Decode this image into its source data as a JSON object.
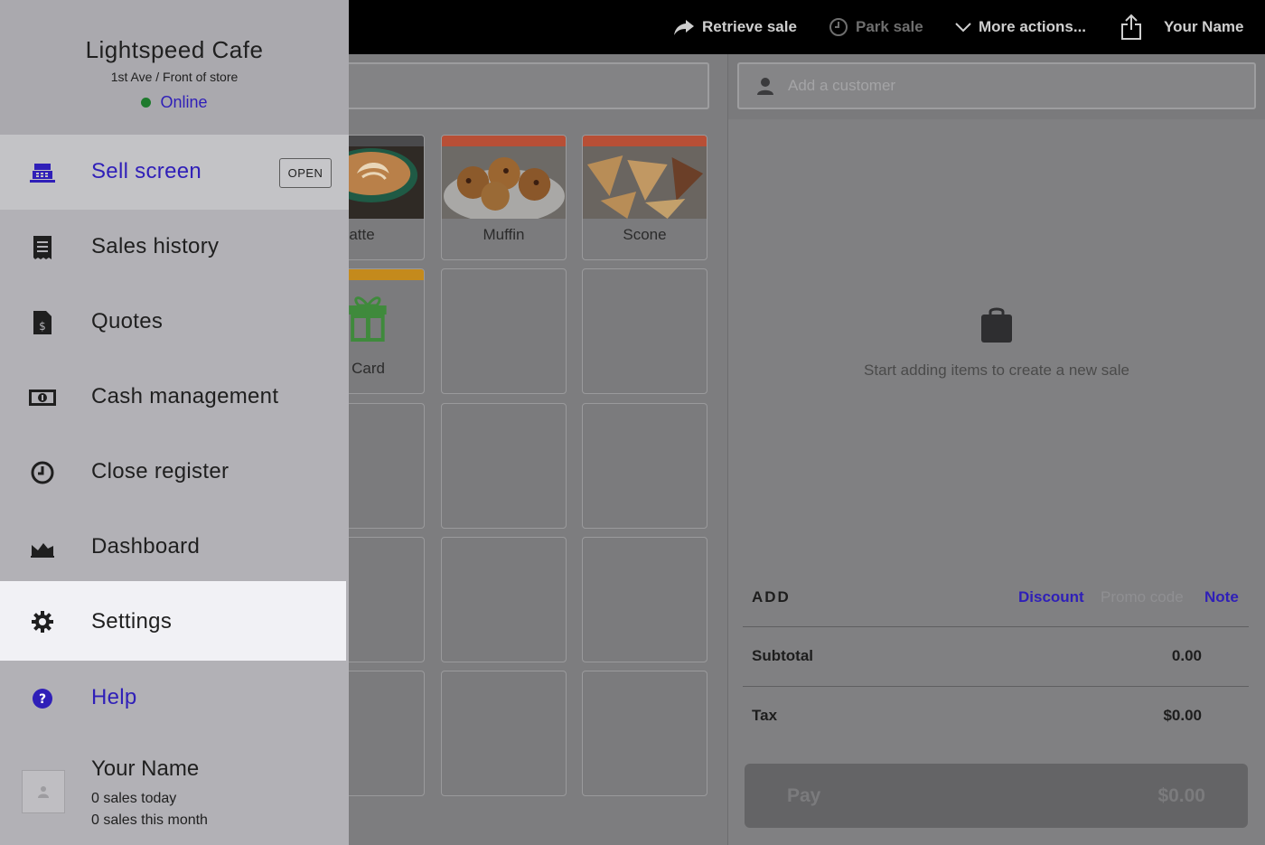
{
  "topbar": {
    "retrieve_sale": "Retrieve sale",
    "park_sale": "Park sale",
    "more_actions": "More actions...",
    "user_name": "Your Name"
  },
  "customer": {
    "placeholder": "Add a customer"
  },
  "products": [
    {
      "label": "atte",
      "bar_color": "#4a4a4c"
    },
    {
      "label": "Muffin",
      "bar_color": "#b84f36"
    },
    {
      "label": "Scone",
      "bar_color": "#b84f36"
    },
    {
      "label": "ft Card",
      "bar_color": "#c48a1c"
    }
  ],
  "sale": {
    "empty_message": "Start adding items to create a new sale",
    "add_label": "ADD",
    "discount": "Discount",
    "promo_code": "Promo code",
    "note": "Note",
    "subtotal_label": "Subtotal",
    "subtotal_value": "0.00",
    "tax_label": "Tax",
    "tax_value": "$0.00",
    "pay_label": "Pay",
    "pay_value": "$0.00"
  },
  "drawer": {
    "store_name": "Lightspeed Cafe",
    "location": "1st Ave / Front of store",
    "status": "Online",
    "open_badge": "OPEN",
    "items": [
      {
        "label": "Sell screen",
        "icon": "register-icon"
      },
      {
        "label": "Sales history",
        "icon": "receipt-icon"
      },
      {
        "label": "Quotes",
        "icon": "quote-document-icon"
      },
      {
        "label": "Cash management",
        "icon": "cash-icon"
      },
      {
        "label": "Close register",
        "icon": "clock-icon"
      },
      {
        "label": "Dashboard",
        "icon": "area-chart-icon"
      },
      {
        "label": "Settings",
        "icon": "gear-icon"
      },
      {
        "label": "Help",
        "icon": "help-icon"
      }
    ],
    "user": {
      "name": "Your Name",
      "sales_today": "0 sales today",
      "sales_month": "0 sales this month"
    }
  },
  "colors": {
    "accent": "#2f1fb8",
    "online": "#1e7a2d",
    "highlight": "#f1f1f5"
  }
}
